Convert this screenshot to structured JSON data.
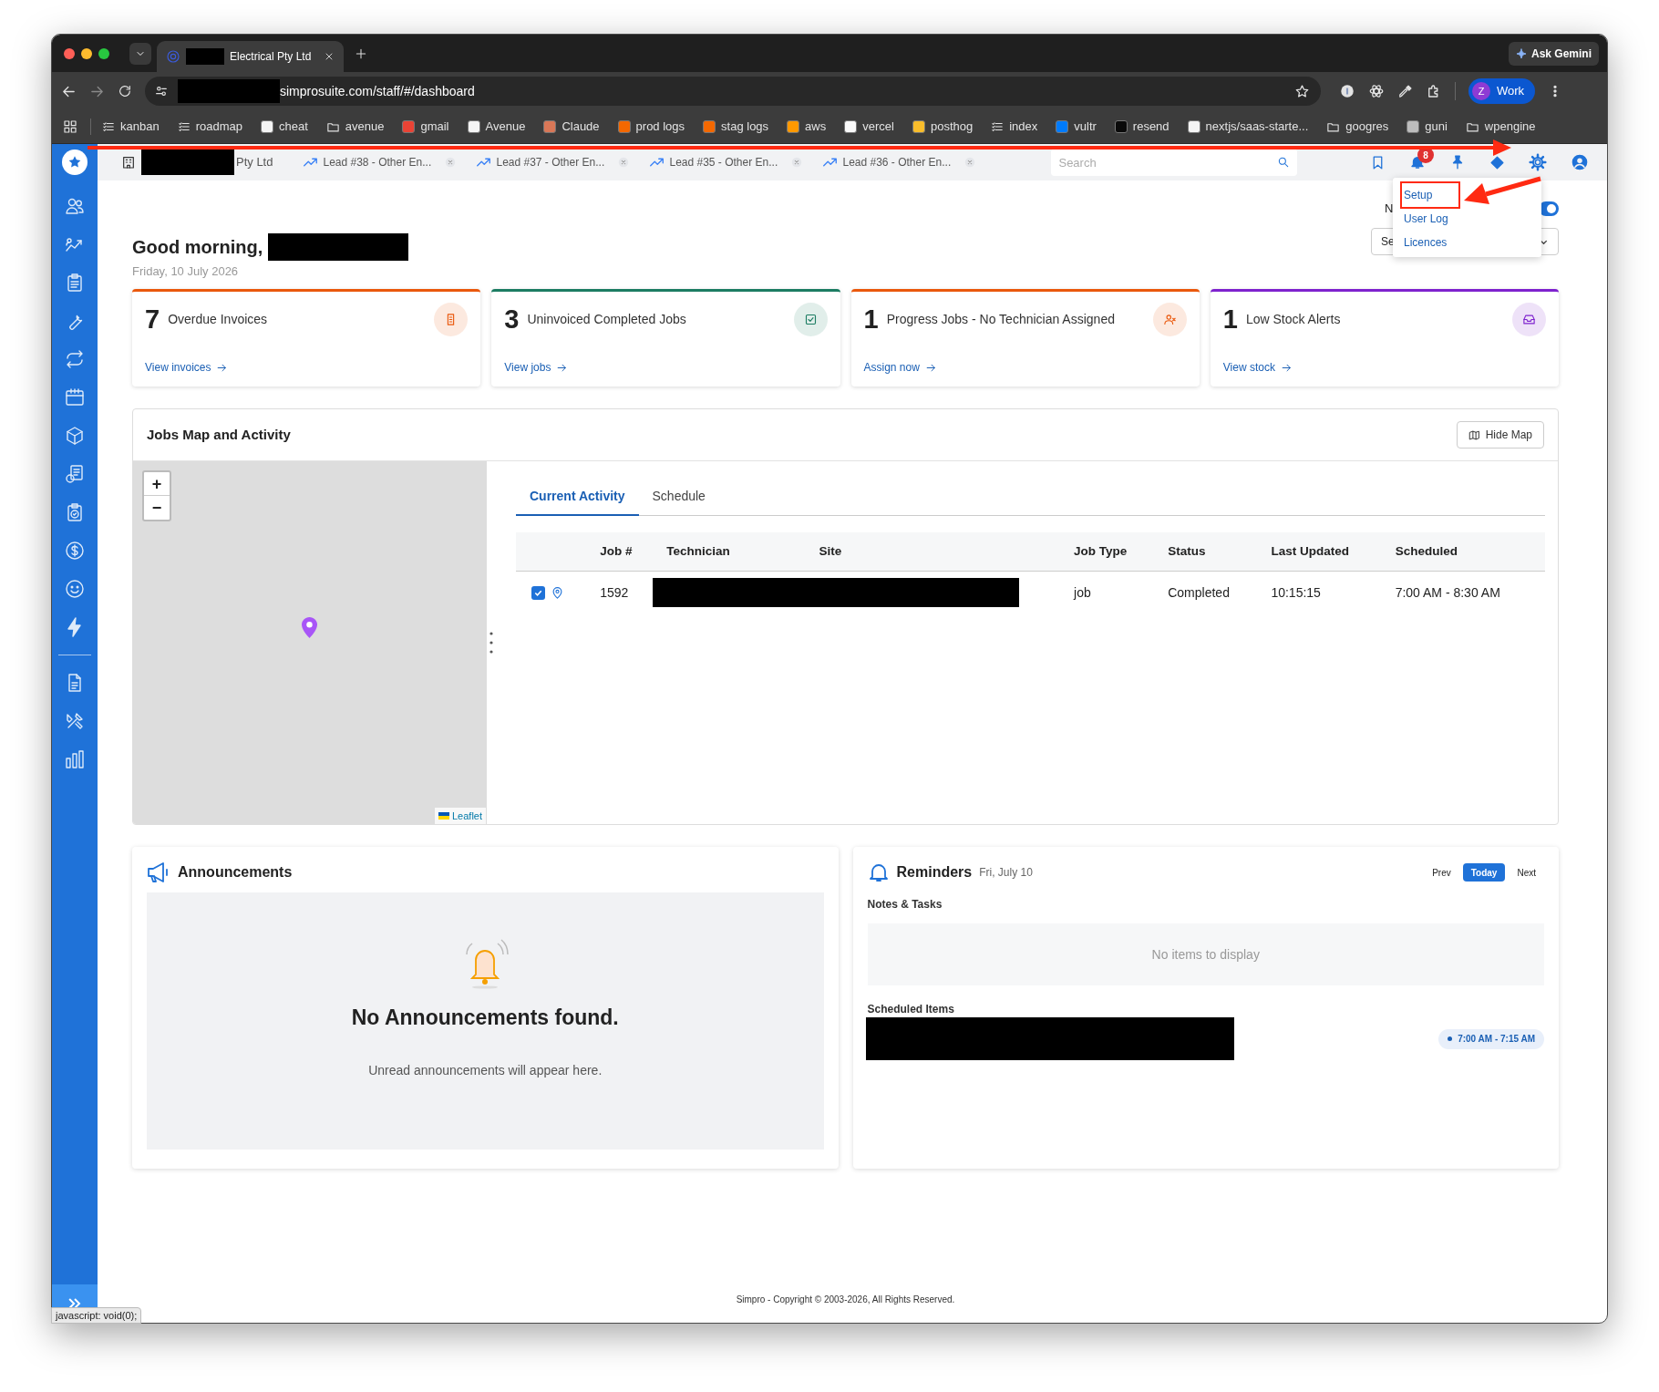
{
  "browser": {
    "tab_title": "Electrical Pty Ltd",
    "ask_button": "Ask Gemini",
    "url": "simprosuite.com/staff/#/dashboard",
    "profile_initial": "Z",
    "profile_name": "Work",
    "bookmarks": [
      {
        "label": "kanban",
        "kind": "list"
      },
      {
        "label": "roadmap",
        "kind": "list"
      },
      {
        "label": "cheat",
        "kind": "site",
        "color": "#f5f5f5"
      },
      {
        "label": "avenue",
        "kind": "folder"
      },
      {
        "label": "gmail",
        "kind": "site",
        "color": "#ea4335"
      },
      {
        "label": "Avenue",
        "kind": "site",
        "color": "#f5f5f5"
      },
      {
        "label": "Claude",
        "kind": "site",
        "color": "#d97757"
      },
      {
        "label": "prod logs",
        "kind": "site",
        "color": "#f46800"
      },
      {
        "label": "stag logs",
        "kind": "site",
        "color": "#f46800"
      },
      {
        "label": "aws",
        "kind": "site",
        "color": "#ff9900"
      },
      {
        "label": "vercel",
        "kind": "site",
        "color": "#fafafa"
      },
      {
        "label": "posthog",
        "kind": "site",
        "color": "#f9bd2b"
      },
      {
        "label": "index",
        "kind": "list"
      },
      {
        "label": "vultr",
        "kind": "site",
        "color": "#007bfc"
      },
      {
        "label": "resend",
        "kind": "site",
        "color": "#0a0a0a"
      },
      {
        "label": "nextjs/saas-starte...",
        "kind": "site",
        "color": "#f5f5f5"
      },
      {
        "label": "googres",
        "kind": "folder"
      },
      {
        "label": "guni",
        "kind": "site",
        "color": "#bdbdbd"
      },
      {
        "label": "wpengine",
        "kind": "folder"
      }
    ]
  },
  "app_header": {
    "company": "Pty Ltd",
    "tabs": [
      "Lead #38 - Other En...",
      "Lead #37 - Other En...",
      "Lead #35 - Other En...",
      "Lead #36 - Other En..."
    ],
    "search": {
      "placeholder": "Search"
    },
    "notification_count": "8"
  },
  "settings_menu": [
    {
      "label": "Setup",
      "annotated": true
    },
    {
      "label": "User Log",
      "annotated": false
    },
    {
      "label": "Licences",
      "annotated": false
    }
  ],
  "greeting": "Good morning,",
  "date": "Friday, 10 July 2026",
  "toggle_label": "N",
  "toggle_on": true,
  "select_value": "Se",
  "stat_cards": [
    {
      "count": "7",
      "title": "Overdue Invoices",
      "link": "View invoices",
      "color": "#ea580c"
    },
    {
      "count": "3",
      "title": "Uninvoiced Completed Jobs",
      "link": "View jobs",
      "color": "#1c7c62"
    },
    {
      "count": "1",
      "title": "Progress Jobs - No Technician Assigned",
      "link": "Assign now",
      "color": "#ea580c"
    },
    {
      "count": "1",
      "title": "Low Stock Alerts",
      "link": "View stock",
      "color": "#7e22ce"
    }
  ],
  "jobs_panel": {
    "title": "Jobs Map and Activity",
    "hide_button": "Hide Map",
    "zoom_in": "+",
    "zoom_out": "−",
    "attribution": "Leaflet",
    "tabs": [
      {
        "label": "Current Activity",
        "selected": true
      },
      {
        "label": "Schedule",
        "selected": false
      }
    ],
    "columns": [
      "Job #",
      "Technician",
      "Site",
      "Job Type",
      "Status",
      "Last Updated",
      "Scheduled"
    ],
    "rows": [
      {
        "checked": true,
        "job": "1592",
        "job_type": "job",
        "status": "Completed",
        "last_updated": "10:15:15",
        "scheduled": "7:00 AM - 8:30 AM"
      }
    ]
  },
  "announcements": {
    "title": "Announcements",
    "empty_title": "No Announcements found.",
    "empty_text": "Unread announcements will appear here."
  },
  "reminders": {
    "title": "Reminders",
    "date": "Fri, July 10",
    "nav": [
      {
        "label": "Prev",
        "selected": false
      },
      {
        "label": "Today",
        "selected": true
      },
      {
        "label": "Next",
        "selected": false
      }
    ],
    "notes_title": "Notes & Tasks",
    "notes_empty": "No items to display",
    "scheduled_title": "Scheduled Items",
    "scheduled_items": [
      {
        "time": "7:00 AM - 7:15 AM"
      }
    ]
  },
  "footer": "Simpro - Copyright © 2003-2026, All Rights Reserved.",
  "status_bar": "javascript: void(0);"
}
